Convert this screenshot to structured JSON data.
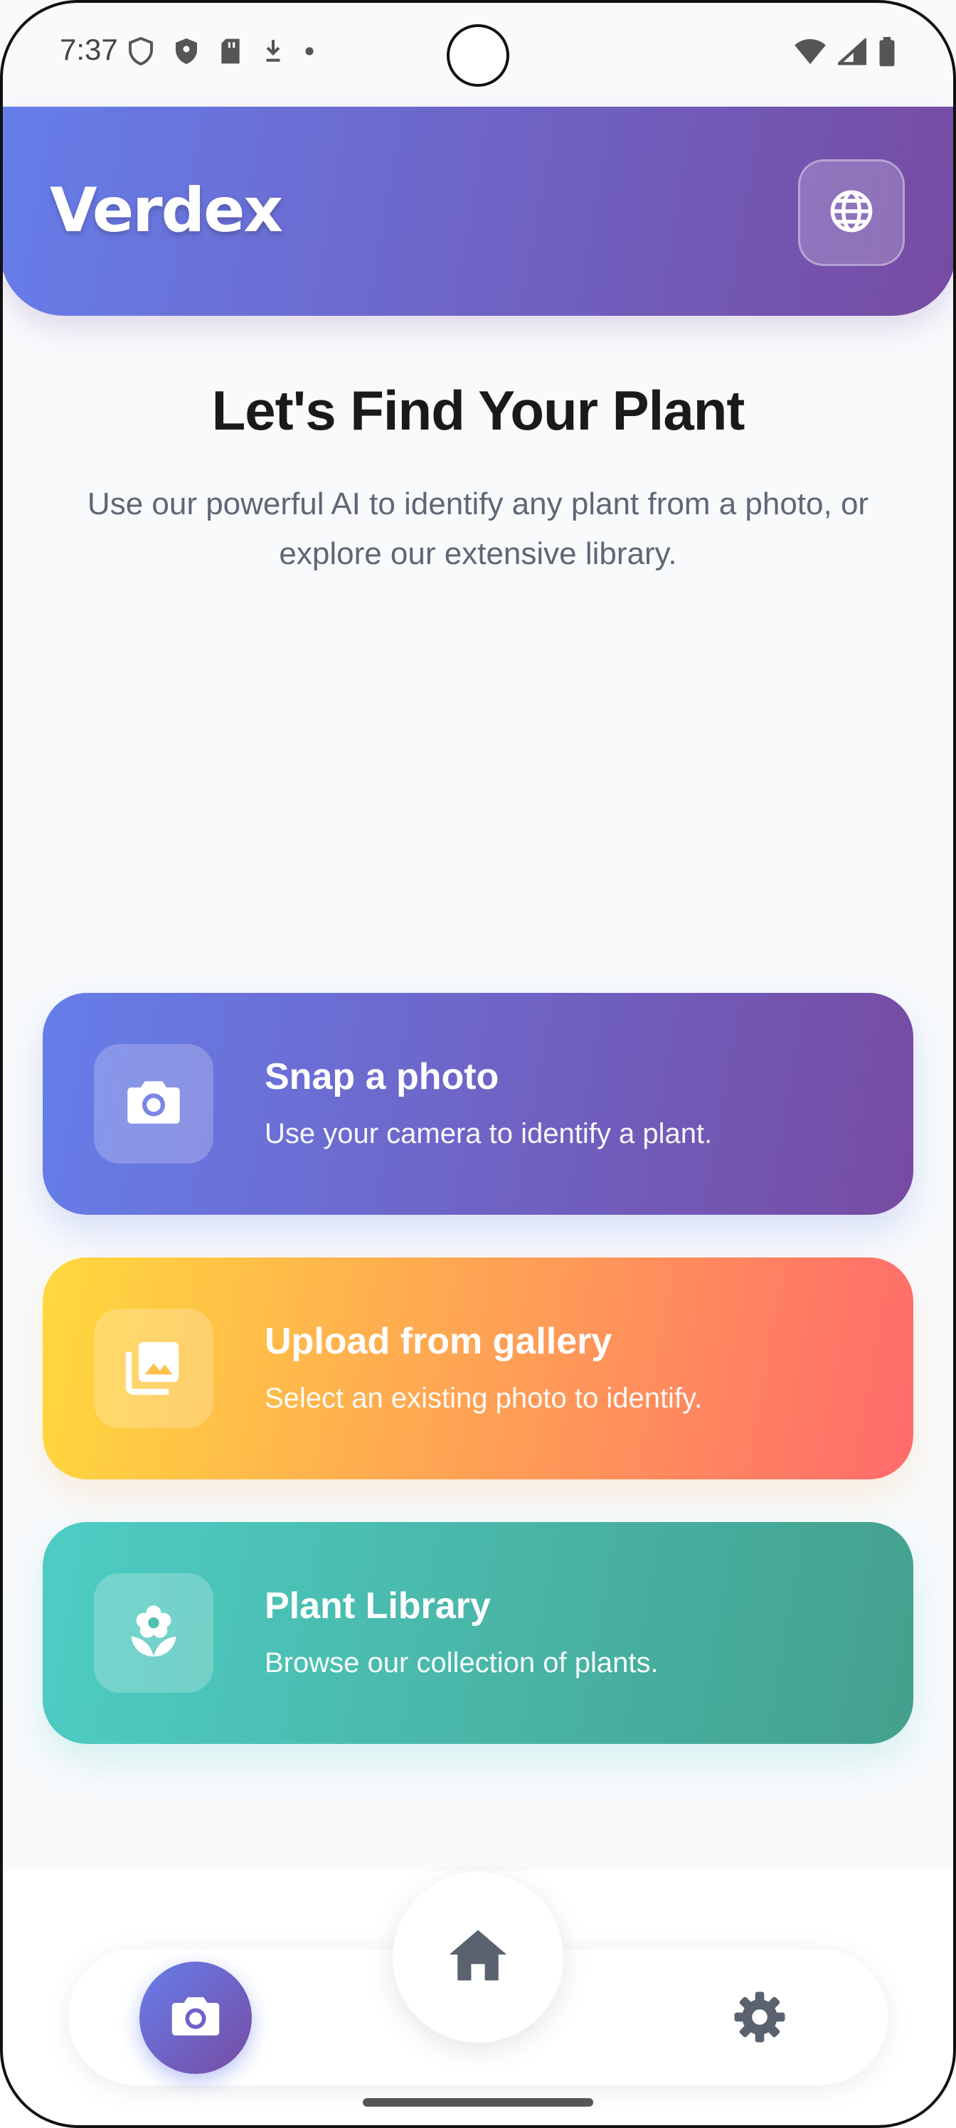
{
  "status_bar": {
    "time": "7:37"
  },
  "header": {
    "title": "Verdex",
    "language_icon": "globe-icon"
  },
  "hero": {
    "title": "Let's Find Your Plant",
    "subtitle": "Use our powerful AI to identify any plant from a photo, or explore our extensive library."
  },
  "cards": [
    {
      "title": "Snap a photo",
      "description": "Use your camera to identify a plant.",
      "icon": "camera-icon"
    },
    {
      "title": "Upload from gallery",
      "description": "Select an existing photo to identify.",
      "icon": "gallery-icon"
    },
    {
      "title": "Plant Library",
      "description": "Browse our collection of plants.",
      "icon": "flower-icon"
    }
  ],
  "nav": {
    "items": [
      {
        "icon": "camera-icon",
        "active": true
      },
      {
        "icon": "home-icon",
        "active": false
      },
      {
        "icon": "gear-icon",
        "active": false
      }
    ]
  },
  "colors": {
    "primary_gradient_start": "#667eea",
    "primary_gradient_end": "#764ba2",
    "upload_gradient_start": "#ffd93d",
    "upload_gradient_end": "#ff6b6b",
    "library_gradient_start": "#4ecdc4",
    "library_gradient_end": "#44a08d",
    "background": "#f8fafc"
  }
}
